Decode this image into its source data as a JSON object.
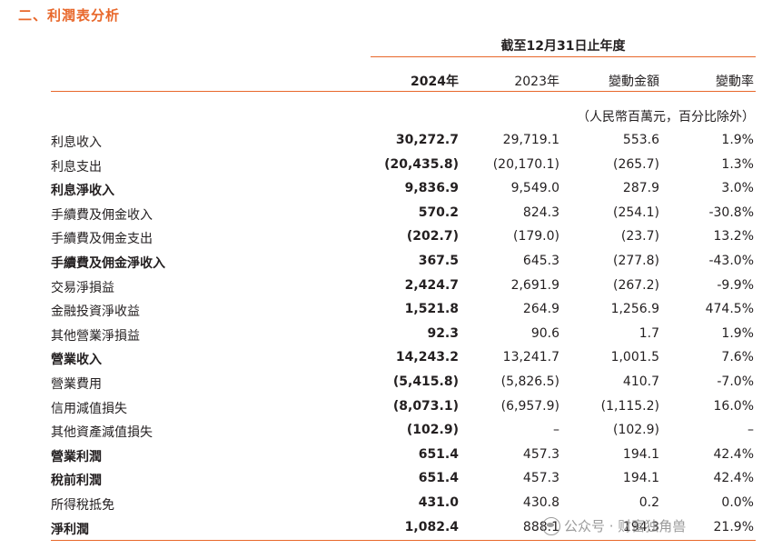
{
  "section_title": "二、利潤表分析",
  "period_header": "截至12月31日止年度",
  "columns": {
    "c2024": "2024年",
    "c2023": "2023年",
    "change_amount": "變動金額",
    "change_rate": "變動率"
  },
  "unit_note": "（人民幣百萬元，百分比除外）",
  "rows": [
    {
      "label": "利息收入",
      "v2024": "30,272.7",
      "v2023": "29,719.1",
      "chg": "553.6",
      "rate": "1.9%",
      "bold": false
    },
    {
      "label": "利息支出",
      "v2024": "(20,435.8)",
      "v2023": "(20,170.1)",
      "chg": "(265.7)",
      "rate": "1.3%",
      "bold": false
    },
    {
      "label": "利息淨收入",
      "v2024": "9,836.9",
      "v2023": "9,549.0",
      "chg": "287.9",
      "rate": "3.0%",
      "bold": true
    },
    {
      "label": "手續費及佣金收入",
      "v2024": "570.2",
      "v2023": "824.3",
      "chg": "(254.1)",
      "rate": "-30.8%",
      "bold": false
    },
    {
      "label": "手續費及佣金支出",
      "v2024": "(202.7)",
      "v2023": "(179.0)",
      "chg": "(23.7)",
      "rate": "13.2%",
      "bold": false
    },
    {
      "label": "手續費及佣金淨收入",
      "v2024": "367.5",
      "v2023": "645.3",
      "chg": "(277.8)",
      "rate": "-43.0%",
      "bold": true
    },
    {
      "label": "交易淨損益",
      "v2024": "2,424.7",
      "v2023": "2,691.9",
      "chg": "(267.2)",
      "rate": "-9.9%",
      "bold": false
    },
    {
      "label": "金融投資淨收益",
      "v2024": "1,521.8",
      "v2023": "264.9",
      "chg": "1,256.9",
      "rate": "474.5%",
      "bold": false
    },
    {
      "label": "其他營業淨損益",
      "v2024": "92.3",
      "v2023": "90.6",
      "chg": "1.7",
      "rate": "1.9%",
      "bold": false
    },
    {
      "label": "營業收入",
      "v2024": "14,243.2",
      "v2023": "13,241.7",
      "chg": "1,001.5",
      "rate": "7.6%",
      "bold": true
    },
    {
      "label": "營業費用",
      "v2024": "(5,415.8)",
      "v2023": "(5,826.5)",
      "chg": "410.7",
      "rate": "-7.0%",
      "bold": false
    },
    {
      "label": "信用減值損失",
      "v2024": "(8,073.1)",
      "v2023": "(6,957.9)",
      "chg": "(1,115.2)",
      "rate": "16.0%",
      "bold": false
    },
    {
      "label": "其他資產減值損失",
      "v2024": "(102.9)",
      "v2023": "–",
      "chg": "(102.9)",
      "rate": "–",
      "bold": false
    },
    {
      "label": "營業利潤",
      "v2024": "651.4",
      "v2023": "457.3",
      "chg": "194.1",
      "rate": "42.4%",
      "bold": true
    },
    {
      "label": "稅前利潤",
      "v2024": "651.4",
      "v2023": "457.3",
      "chg": "194.1",
      "rate": "42.4%",
      "bold": true
    },
    {
      "label": "所得稅抵免",
      "v2024": "431.0",
      "v2023": "430.8",
      "chg": "0.2",
      "rate": "0.0%",
      "bold": false
    },
    {
      "label": "淨利潤",
      "v2024": "1,082.4",
      "v2023": "888.1",
      "chg": "194.3",
      "rate": "21.9%",
      "bold": true
    }
  ],
  "watermark": "公众号 · 财富独角兽",
  "colors": {
    "accent": "#e8672a"
  }
}
